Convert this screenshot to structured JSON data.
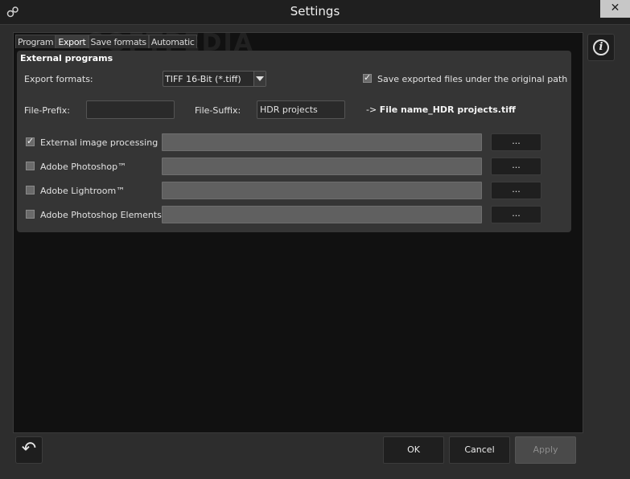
{
  "window": {
    "title": "Settings",
    "close_label": "✕"
  },
  "tabs": [
    {
      "label": "Program"
    },
    {
      "label": "Export"
    },
    {
      "label": "Save formats"
    },
    {
      "label": "Automatic"
    }
  ],
  "watermark": "SOFTPEDIA",
  "external_programs": {
    "title": "External programs",
    "export_formats_label": "Export formats:",
    "export_format_value": "TIFF 16-Bit (*.tiff)",
    "save_original_path_label": "Save exported files under the original path",
    "save_original_path_checked": true,
    "file_prefix_label": "File-Prefix:",
    "file_prefix_value": "",
    "file_suffix_label": "File-Suffix:",
    "file_suffix_value": "HDR projects",
    "result_prefix": "-> ",
    "result_filename": "File name_HDR projects.tiff",
    "programs": [
      {
        "label": "External image processing",
        "checked": true,
        "path": "",
        "browse_label": "..."
      },
      {
        "label": "Adobe Photoshop™",
        "checked": false,
        "path": "",
        "browse_label": "..."
      },
      {
        "label": "Adobe Lightroom™",
        "checked": false,
        "path": "",
        "browse_label": "..."
      },
      {
        "label": "Adobe Photoshop Elements™",
        "checked": false,
        "path": "",
        "browse_label": "..."
      }
    ]
  },
  "footer": {
    "back_icon": "↶",
    "ok_label": "OK",
    "cancel_label": "Cancel",
    "apply_label": "Apply"
  },
  "info_icon": "i",
  "check_glyph": "✓"
}
